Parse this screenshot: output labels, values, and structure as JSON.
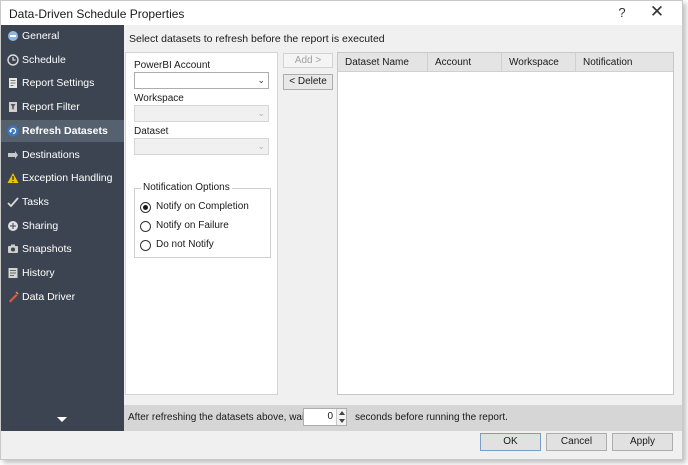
{
  "window": {
    "title": "Data-Driven Schedule Properties",
    "help_label": "?",
    "close_label": "✕"
  },
  "sidebar": {
    "items": [
      {
        "label": "General",
        "icon": "general-icon",
        "active": false
      },
      {
        "label": "Schedule",
        "icon": "clock-icon",
        "active": false
      },
      {
        "label": "Report Settings",
        "icon": "report-settings-icon",
        "active": false
      },
      {
        "label": "Report Filter",
        "icon": "filter-icon",
        "active": false
      },
      {
        "label": "Refresh Datasets",
        "icon": "refresh-icon",
        "active": true
      },
      {
        "label": "Destinations",
        "icon": "destinations-icon",
        "active": false
      },
      {
        "label": "Exception Handling",
        "icon": "warning-icon",
        "active": false
      },
      {
        "label": "Tasks",
        "icon": "tasks-icon",
        "active": false
      },
      {
        "label": "Sharing",
        "icon": "sharing-icon",
        "active": false
      },
      {
        "label": "Snapshots",
        "icon": "snapshots-icon",
        "active": false
      },
      {
        "label": "History",
        "icon": "history-icon",
        "active": false
      },
      {
        "label": "Data Driver",
        "icon": "data-driver-icon",
        "active": false
      }
    ]
  },
  "main": {
    "instructions": "Select datasets to refresh before the report is executed",
    "powerbi_account_label": "PowerBI Account",
    "powerbi_account_value": "",
    "workspace_label": "Workspace",
    "workspace_value": "",
    "dataset_label": "Dataset",
    "dataset_value": "",
    "notification_options_label": "Notification Options",
    "notify_options": [
      {
        "label": "Notify on Completion",
        "checked": true
      },
      {
        "label": "Notify on Failure",
        "checked": false
      },
      {
        "label": "Do not Notify",
        "checked": false
      }
    ],
    "add_label": "Add >",
    "delete_label": "< Delete",
    "grid_columns": [
      "Dataset Name",
      "Account",
      "Workspace",
      "Notification"
    ],
    "grid_rows": []
  },
  "wait": {
    "prefix": "After refreshing the datasets above, wait",
    "value": "0",
    "suffix": "seconds before running the report."
  },
  "footer": {
    "ok_label": "OK",
    "cancel_label": "Cancel",
    "apply_label": "Apply"
  },
  "colors": {
    "sidebar_bg": "#3b4450",
    "sidebar_active": "#566170",
    "content_bg": "#f0f0f0"
  }
}
